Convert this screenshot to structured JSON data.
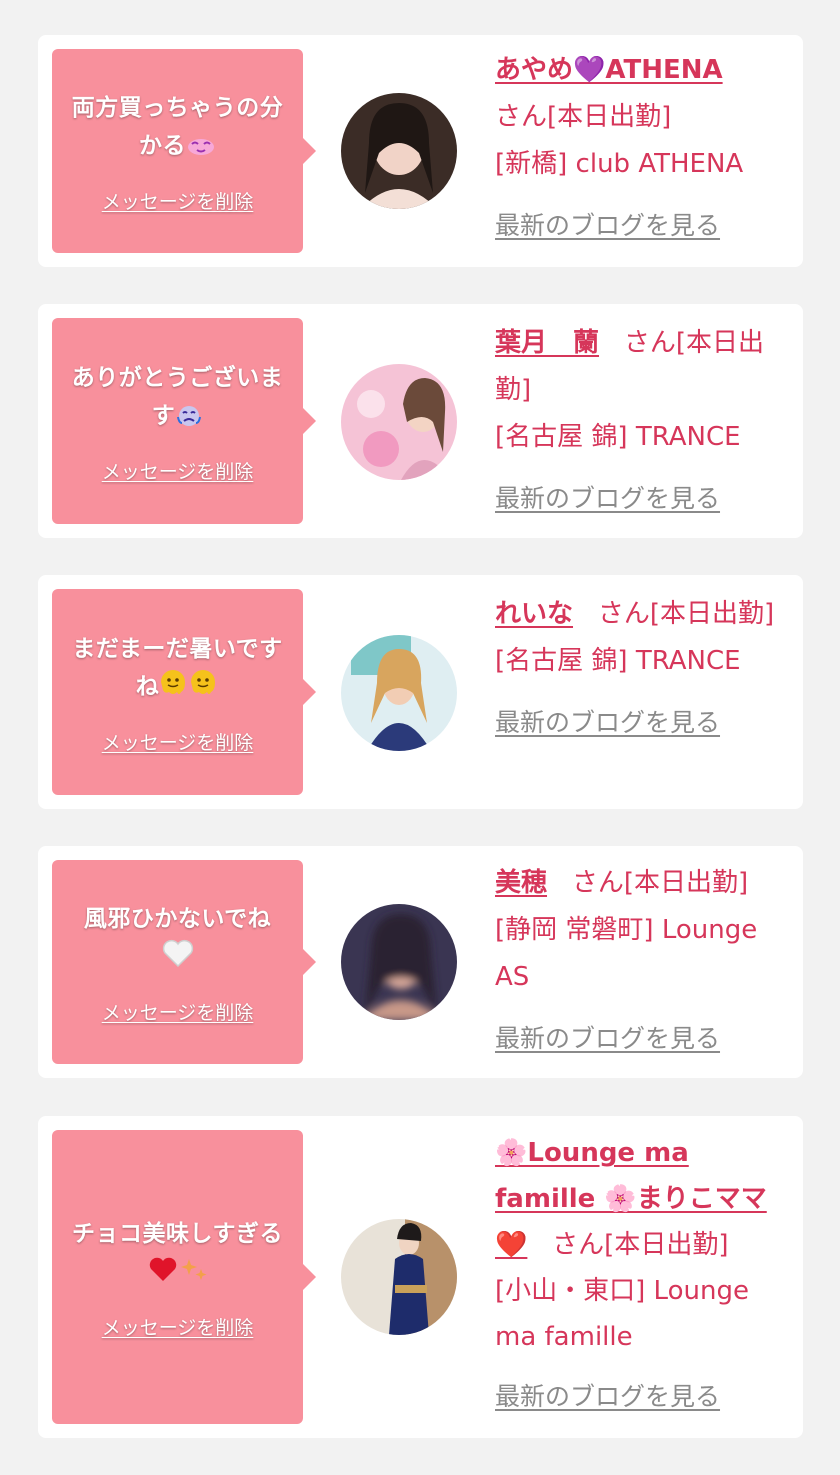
{
  "colors": {
    "accent": "#d6365a",
    "bubble": "#f8909c",
    "link_gray": "#8a8a8a"
  },
  "cards": [
    {
      "message": "両方買っちゃうの分かる",
      "message_emoji": "kiss-face-icon",
      "delete_label": "メッセージを削除",
      "name": "あやめ💜ATHENA",
      "suffix": "さん[本日出勤]",
      "location": "[新橋] club ATHENA",
      "blog_label": "最新のブログを見る"
    },
    {
      "message": "ありがとうございます",
      "message_emoji": "crying-face-icon",
      "delete_label": "メッセージを削除",
      "name": "葉月　蘭",
      "suffix": "さん[本日出勤]",
      "location": "[名古屋 錦] TRANCE",
      "blog_label": "最新のブログを見る"
    },
    {
      "message": "まだまーだ暑いですね",
      "message_emoji": "melting-face-icon",
      "delete_label": "メッセージを削除",
      "name": "れいな",
      "suffix": "さん[本日出勤]",
      "location": "[名古屋 錦] TRANCE",
      "blog_label": "最新のブログを見る"
    },
    {
      "message": "風邪ひかないでね",
      "message_emoji": "white-heart-icon",
      "delete_label": "メッセージを削除",
      "name": "美穂",
      "suffix": "さん[本日出勤]",
      "location": "[静岡 常磐町] Lounge AS",
      "blog_label": "最新のブログを見る"
    },
    {
      "message": "チョコ美味しすぎる",
      "message_emoji": "red-heart-icon",
      "delete_label": "メッセージを削除",
      "name": "🌸Lounge ma famille 🌸まりこママ❤️",
      "suffix": "さん[本日出勤]",
      "location": "[小山・東口] Lounge ma famille",
      "blog_label": "最新のブログを見る"
    }
  ]
}
